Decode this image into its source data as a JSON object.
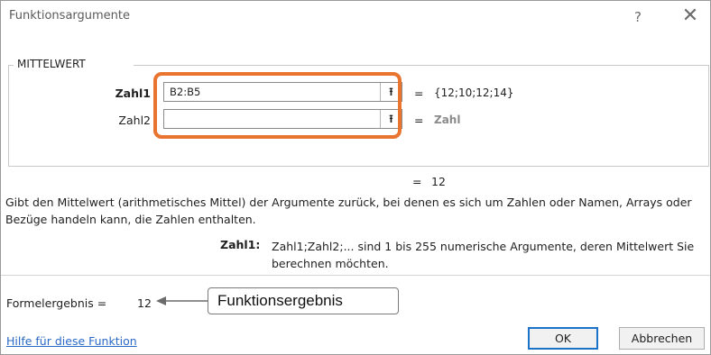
{
  "window": {
    "title": "Funktionsargumente",
    "help_symbol": "?",
    "close_symbol": "✕"
  },
  "function": {
    "name": "MITTELWERT",
    "arguments": [
      {
        "label": "Zahl1",
        "value": "B2:B5",
        "result": "{12;10;12;14}",
        "bold": true
      },
      {
        "label": "Zahl2",
        "value": "",
        "result": "Zahl",
        "bold": false
      }
    ],
    "equals": "=",
    "total_result": "12",
    "description": "Gibt den Mittelwert (arithmetisches Mittel) der Argumente zurück, bei denen es sich um Zahlen oder Namen, Arrays oder Bezüge handeln kann, die Zahlen enthalten.",
    "arg_description_label": "Zahl1:",
    "arg_description": "Zahl1;Zahl2;... sind 1 bis 255 numerische Argumente, deren Mittelwert Sie berechnen möchten."
  },
  "formula_result": {
    "label": "Formelergebnis =",
    "value": "12"
  },
  "annotation": {
    "callout_text": "Funktionsergebnis",
    "highlight_color": "#e8742f"
  },
  "footer": {
    "help_link": "Hilfe für diese Funktion",
    "ok_label": "OK",
    "cancel_label": "Abbrechen"
  },
  "icons": {
    "collapse_dialog": "collapse-dialog-icon",
    "collapse_glyph": "⭱"
  }
}
